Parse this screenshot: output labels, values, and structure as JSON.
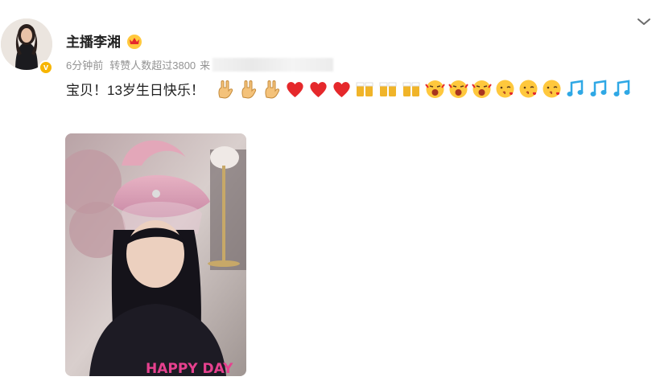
{
  "post": {
    "author_name": "主播李湘",
    "time": "6分钟前",
    "reposts": "转赞人数超过3800",
    "source_prefix": "来自",
    "text": "宝贝！13岁生日快乐！",
    "emojis": [
      "rock-hand",
      "rock-hand",
      "rock-hand",
      "heart",
      "heart",
      "heart",
      "beer",
      "beer",
      "beer",
      "excited-face",
      "excited-face",
      "excited-face",
      "kiss-face",
      "kiss-face",
      "kiss-face",
      "music-note",
      "music-note",
      "music-note"
    ],
    "photo_text": "HAPPY DAY"
  },
  "colors": {
    "verified": "#f7b500",
    "heart": "#e5282b",
    "note": "#2fa8e5",
    "beer": "#f0b429",
    "face": "#ffc83d"
  },
  "icons": {
    "more": "chevron-down-icon",
    "verified": "verified-badge-icon",
    "crown": "crown-icon"
  }
}
